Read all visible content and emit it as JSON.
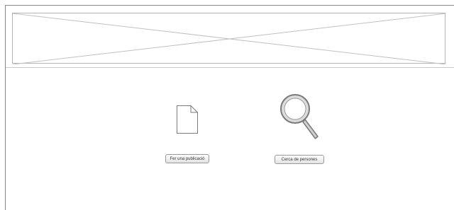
{
  "banner": {
    "kind": "image-placeholder"
  },
  "actions": {
    "publish": {
      "icon": "file-icon",
      "label": "Fer una publicació"
    },
    "search_people": {
      "icon": "magnifier-icon",
      "label": "Cerca de persones"
    }
  },
  "colors": {
    "border": "#8a8a8a",
    "placeholder_line": "#c0c0c0",
    "icon_stroke": "#7a7a7a",
    "icon_fill": "#dddddd"
  }
}
